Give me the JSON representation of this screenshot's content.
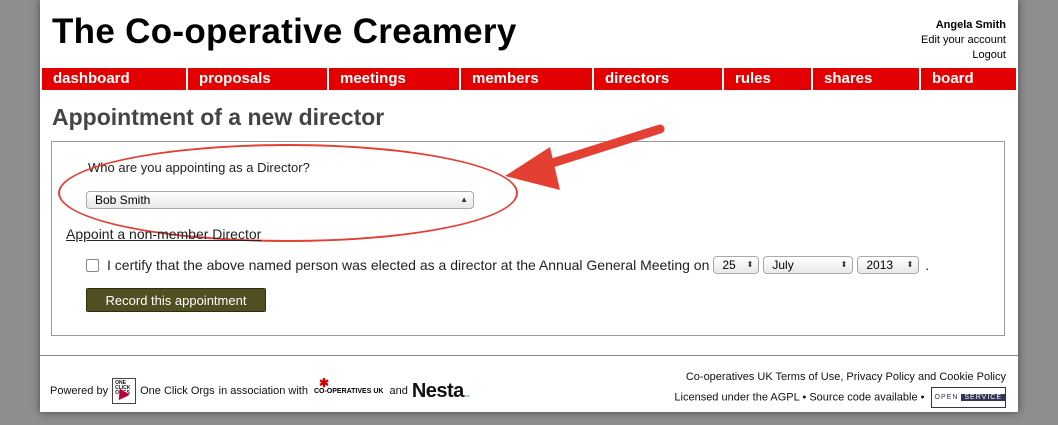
{
  "site": {
    "title": "The Co-operative Creamery"
  },
  "user": {
    "name": "Angela Smith",
    "edit_account": "Edit your account",
    "logout": "Logout"
  },
  "nav": [
    "dashboard",
    "proposals",
    "meetings",
    "members",
    "directors",
    "rules",
    "shares",
    "board"
  ],
  "page": {
    "heading": "Appointment of a new director"
  },
  "form": {
    "question": "Who are you appointing as a Director?",
    "selected_member": "Bob Smith",
    "non_member_link": "Appoint a non-member Director",
    "certify_text": "I certify that the above named person was elected as a director at the Annual General Meeting on",
    "certify_checked": false,
    "day": "25",
    "month": "July",
    "year": "2013",
    "period": ".",
    "submit_label": "Record this appointment"
  },
  "footer": {
    "powered_by": "Powered by",
    "oco_logo_text": "ONE CLICK ORGS",
    "oco_name": "One Click Orgs",
    "in_association": "in association with",
    "coop_logo": "CO-OPERATIVES UK",
    "and": "and",
    "nesta": "Nesta",
    "terms_prefix": "Co-operatives UK",
    "terms_link": "Terms of Use, Privacy Policy and Cookie Policy",
    "license_text": "Licensed under the AGPL",
    "source_link": "Source code available",
    "badge_open": "OPEN",
    "badge_service": "SERVICE"
  },
  "colors": {
    "nav": "#e30000",
    "annotation": "#e43f33",
    "button": "#4f4f22"
  },
  "icons": {
    "annotation": "arrow-annotation-icon"
  }
}
